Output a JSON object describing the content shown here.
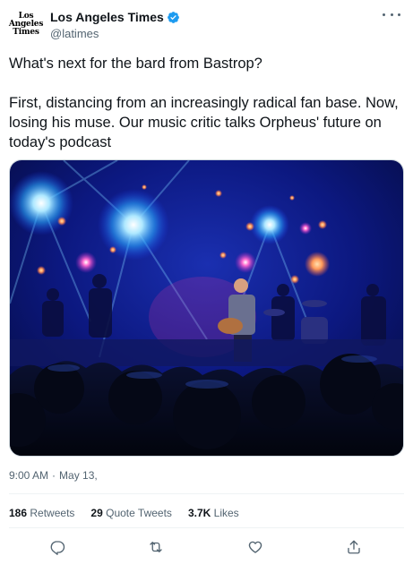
{
  "tweet": {
    "author_name": "Los Angeles Times",
    "author_handle": "@latimes",
    "avatar_logo": [
      "Los",
      "Angeles",
      "Times"
    ],
    "paragraph_1": "What's next for the bard from Bastrop?",
    "paragraph_2": "First, distancing from an increasingly radical fan base. Now, losing his muse. Our music critic talks Orpheus' future on today's podcast",
    "time": "9:00 AM",
    "separator": "·",
    "date": "May 13,",
    "media_icon": "concert-stage-photo"
  },
  "stats": {
    "retweets_count": "186",
    "retweets_label": "Retweets",
    "quotes_count": "29",
    "quotes_label": "Quote Tweets",
    "likes_count": "3.7K",
    "likes_label": "Likes"
  },
  "actions": [
    {
      "icon": "reply-icon"
    },
    {
      "icon": "retweet-icon"
    },
    {
      "icon": "like-icon"
    },
    {
      "icon": "share-icon"
    }
  ],
  "colors": {
    "text": "#0f1419",
    "secondary": "#536471",
    "verified": "#1d9bf0",
    "divider": "#eff3f4"
  }
}
